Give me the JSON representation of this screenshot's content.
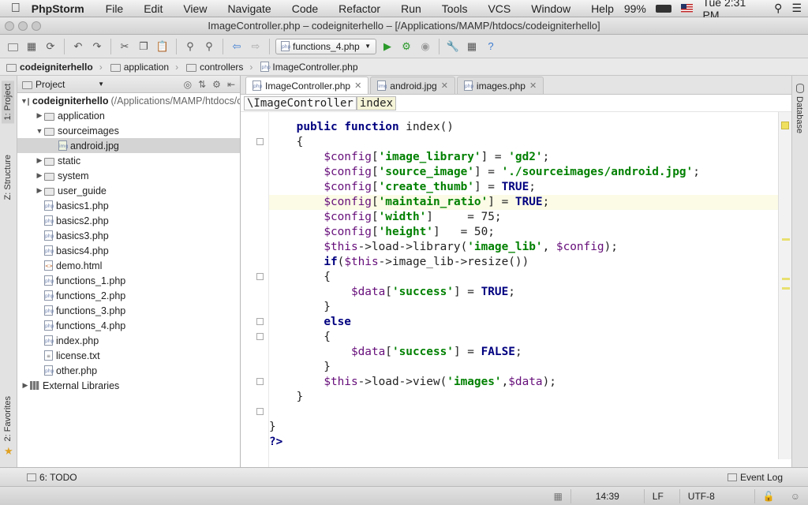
{
  "menubar": {
    "app_name": "PhpStorm",
    "items": [
      "File",
      "Edit",
      "View",
      "Navigate",
      "Code",
      "Refactor",
      "Run",
      "Tools",
      "VCS",
      "Window",
      "Help"
    ],
    "battery": "99%",
    "clock": "Tue 2:31 PM"
  },
  "window": {
    "title": "ImageController.php – codeigniterhello – [/Applications/MAMP/htdocs/codeigniterhello]"
  },
  "toolbar": {
    "run_config": "functions_4.php"
  },
  "breadcrumbs": [
    "codeigniterhello",
    "application",
    "controllers",
    "ImageController.php"
  ],
  "project_panel": {
    "title": "Project",
    "root_name": "codeigniterhello",
    "root_path": "(/Applications/MAMP/htdocs/codeigniterhello)",
    "tree": [
      {
        "label": "application",
        "kind": "folder",
        "depth": 1,
        "arrow": "▶"
      },
      {
        "label": "sourceimages",
        "kind": "folder",
        "depth": 1,
        "arrow": "▼"
      },
      {
        "label": "android.jpg",
        "kind": "image",
        "depth": 2,
        "arrow": ""
      },
      {
        "label": "static",
        "kind": "folder",
        "depth": 1,
        "arrow": "▶"
      },
      {
        "label": "system",
        "kind": "folder",
        "depth": 1,
        "arrow": "▶"
      },
      {
        "label": "user_guide",
        "kind": "folder",
        "depth": 1,
        "arrow": "▶"
      },
      {
        "label": "basics1.php",
        "kind": "php",
        "depth": 1,
        "arrow": ""
      },
      {
        "label": "basics2.php",
        "kind": "php",
        "depth": 1,
        "arrow": ""
      },
      {
        "label": "basics3.php",
        "kind": "php",
        "depth": 1,
        "arrow": ""
      },
      {
        "label": "basics4.php",
        "kind": "php",
        "depth": 1,
        "arrow": ""
      },
      {
        "label": "demo.html",
        "kind": "html",
        "depth": 1,
        "arrow": ""
      },
      {
        "label": "functions_1.php",
        "kind": "php",
        "depth": 1,
        "arrow": ""
      },
      {
        "label": "functions_2.php",
        "kind": "php",
        "depth": 1,
        "arrow": ""
      },
      {
        "label": "functions_3.php",
        "kind": "php",
        "depth": 1,
        "arrow": ""
      },
      {
        "label": "functions_4.php",
        "kind": "php",
        "depth": 1,
        "arrow": ""
      },
      {
        "label": "index.php",
        "kind": "php",
        "depth": 1,
        "arrow": ""
      },
      {
        "label": "license.txt",
        "kind": "txt",
        "depth": 1,
        "arrow": ""
      },
      {
        "label": "other.php",
        "kind": "php",
        "depth": 1,
        "arrow": ""
      }
    ],
    "external": "External Libraries"
  },
  "tabs": [
    {
      "label": "ImageController.php",
      "active": true
    },
    {
      "label": "android.jpg",
      "active": false
    },
    {
      "label": "images.php",
      "active": false
    }
  ],
  "editor_breadcrumb": {
    "class": "\\ImageController",
    "method": "index"
  },
  "side_tabs": {
    "project": "1: Project",
    "structure": "Z: Structure",
    "favorites": "2: Favorites",
    "database": "Database"
  },
  "code_lines": [
    "    public function index()",
    "    {",
    "        $config['image_library'] = 'gd2';",
    "        $config['source_image'] = './sourceimages/android.jpg';",
    "        $config['create_thumb'] = TRUE;",
    "        $config['maintain_ratio'] = TRUE;",
    "        $config['width']     = 75;",
    "        $config['height']   = 50;",
    "        $this->load->library('image_lib', $config);",
    "        if($this->image_lib->resize())",
    "        {",
    "            $data['success'] = TRUE;",
    "        }",
    "        else",
    "        {",
    "            $data['success'] = FALSE;",
    "        }",
    "        $this->load->view('images',$data);",
    "    }",
    "",
    "}",
    "?>"
  ],
  "status": {
    "todo": "6: TODO",
    "event_log": "Event Log",
    "position": "14:39",
    "line_sep": "LF",
    "encoding": "UTF-8"
  }
}
